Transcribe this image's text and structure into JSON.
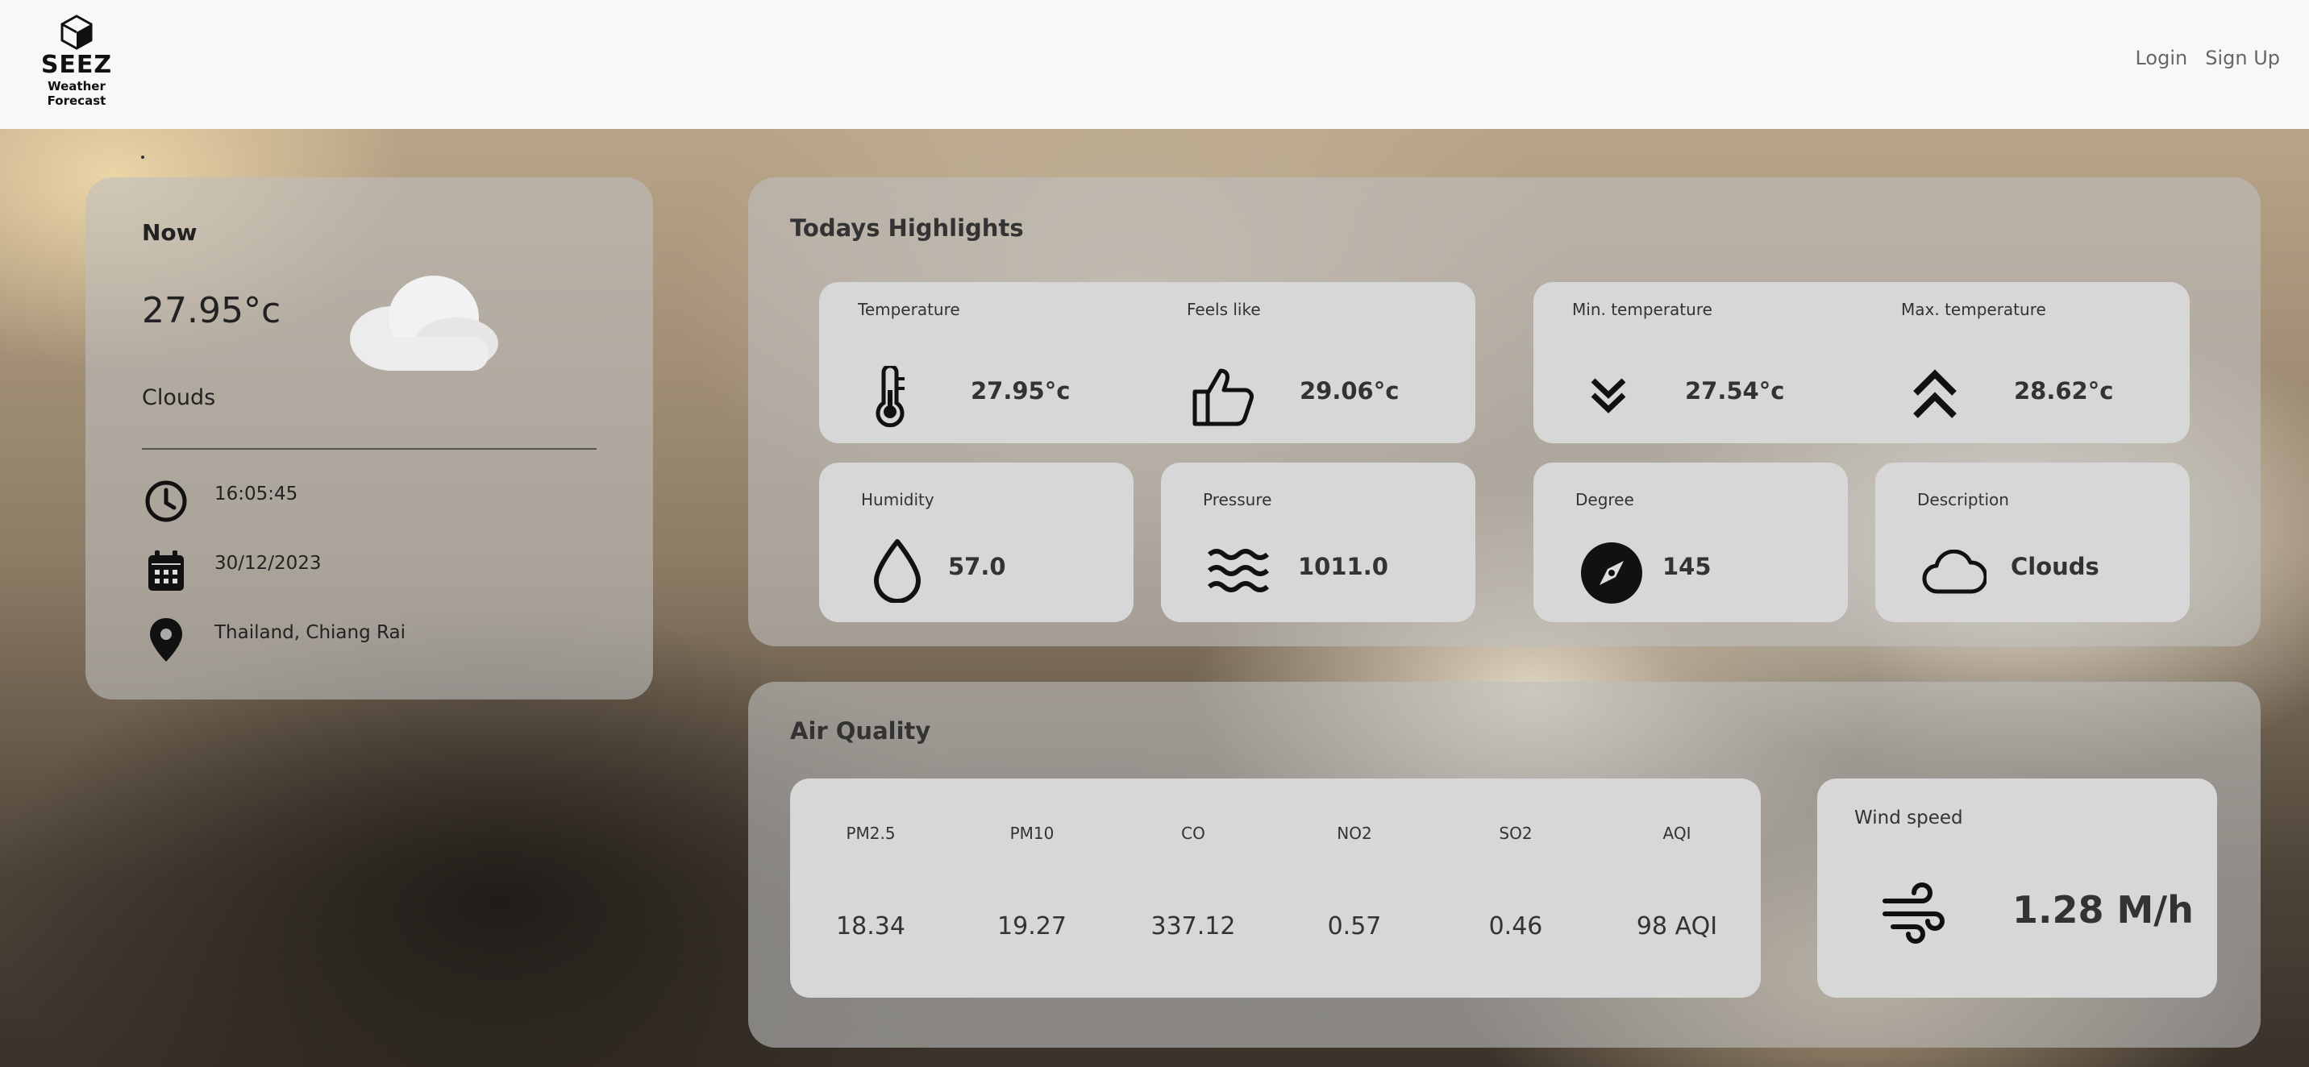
{
  "header": {
    "logo_name": "SEEZ",
    "logo_sub": "Weather Forecast",
    "nav": {
      "login": "Login",
      "signup": "Sign Up"
    }
  },
  "now": {
    "title": "Now",
    "temperature": "27.95°c",
    "description": "Clouds",
    "time": "16:05:45",
    "date": "30/12/2023",
    "location": "Thailand, Chiang Rai"
  },
  "highlights": {
    "title": "Todays Highlights",
    "temperature": {
      "label": "Temperature",
      "value": "27.95°c",
      "icon": "thermometer-icon"
    },
    "feels_like": {
      "label": "Feels like",
      "value": "29.06°c",
      "icon": "thumbs-up-icon"
    },
    "min_temp": {
      "label": "Min. temperature",
      "value": "27.54°c",
      "icon": "chevrons-down-icon"
    },
    "max_temp": {
      "label": "Max. temperature",
      "value": "28.62°c",
      "icon": "chevrons-up-icon"
    },
    "humidity": {
      "label": "Humidity",
      "value": "57.0",
      "icon": "droplet-icon"
    },
    "pressure": {
      "label": "Pressure",
      "value": "1011.0",
      "icon": "waves-icon"
    },
    "degree": {
      "label": "Degree",
      "value": "145",
      "icon": "compass-icon"
    },
    "description": {
      "label": "Description",
      "value": "Clouds",
      "icon": "cloud-icon"
    }
  },
  "air_quality": {
    "title": "Air Quality",
    "items": [
      {
        "label": "PM2.5",
        "value": "18.34"
      },
      {
        "label": "PM10",
        "value": "19.27"
      },
      {
        "label": "CO",
        "value": "337.12"
      },
      {
        "label": "NO2",
        "value": "0.57"
      },
      {
        "label": "SO2",
        "value": "0.46"
      },
      {
        "label": "AQI",
        "value": "98 AQI"
      }
    ]
  },
  "wind": {
    "label": "Wind speed",
    "value": "1.28 M/h",
    "icon": "wind-icon"
  }
}
